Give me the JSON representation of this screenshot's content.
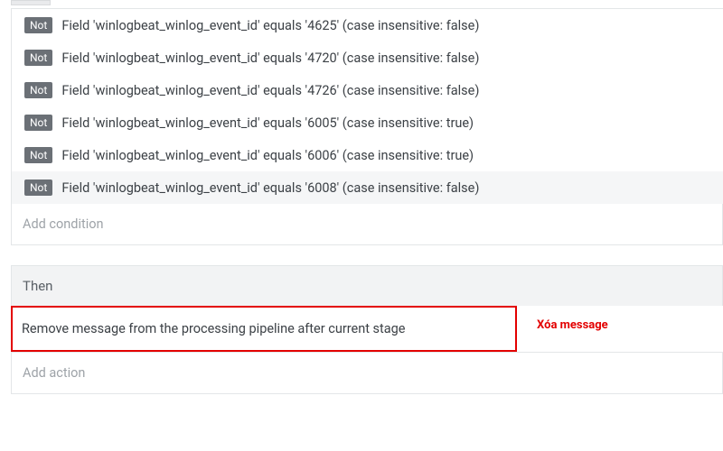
{
  "conditions": [
    {
      "not_label": "Not",
      "text": "Field 'winlogbeat_winlog_event_id' equals '4625' (case insensitive: false)",
      "hovered": false
    },
    {
      "not_label": "Not",
      "text": "Field 'winlogbeat_winlog_event_id' equals '4720' (case insensitive: false)",
      "hovered": false
    },
    {
      "not_label": "Not",
      "text": "Field 'winlogbeat_winlog_event_id' equals '4726' (case insensitive: false)",
      "hovered": false
    },
    {
      "not_label": "Not",
      "text": "Field 'winlogbeat_winlog_event_id' equals '6005' (case insensitive: true)",
      "hovered": false
    },
    {
      "not_label": "Not",
      "text": "Field 'winlogbeat_winlog_event_id' equals '6006' (case insensitive: true)",
      "hovered": false
    },
    {
      "not_label": "Not",
      "text": "Field 'winlogbeat_winlog_event_id' equals '6008' (case insensitive: false)",
      "hovered": true
    }
  ],
  "add_condition_placeholder": "Add condition",
  "then_label": "Then",
  "action_text": "Remove message from the processing pipeline after current stage",
  "annotation_text": "Xóa message",
  "add_action_placeholder": "Add action"
}
